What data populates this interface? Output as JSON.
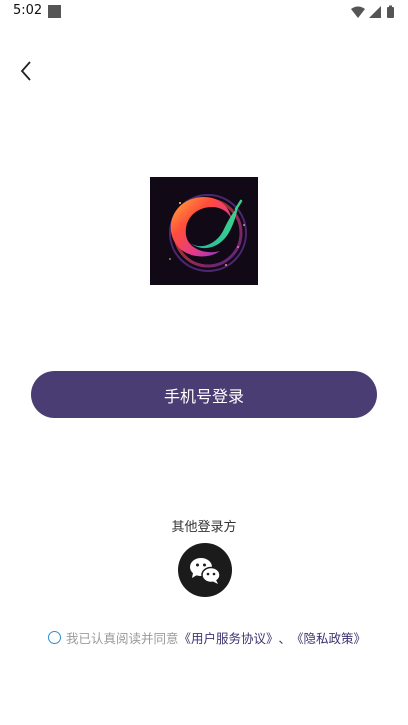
{
  "status_bar": {
    "time": "5:02",
    "icons": [
      "wifi-icon",
      "signal-icon",
      "battery-icon"
    ]
  },
  "header": {
    "back_icon": "chevron-left-icon"
  },
  "logo": {
    "icon": "chili-swirl-logo"
  },
  "login": {
    "phone_button_label": "手机号登录",
    "other_methods_label": "其他登录方",
    "wechat_icon": "wechat-icon"
  },
  "agreement": {
    "prefix": "我已认真阅读并同意",
    "user_agreement": "《用户服务协议》",
    "separator": "、",
    "privacy_policy": "《隐私政策》"
  },
  "colors": {
    "primary_button": "#4a3d73",
    "link": "#3c3470",
    "checkbox": "#2a8dd8"
  }
}
